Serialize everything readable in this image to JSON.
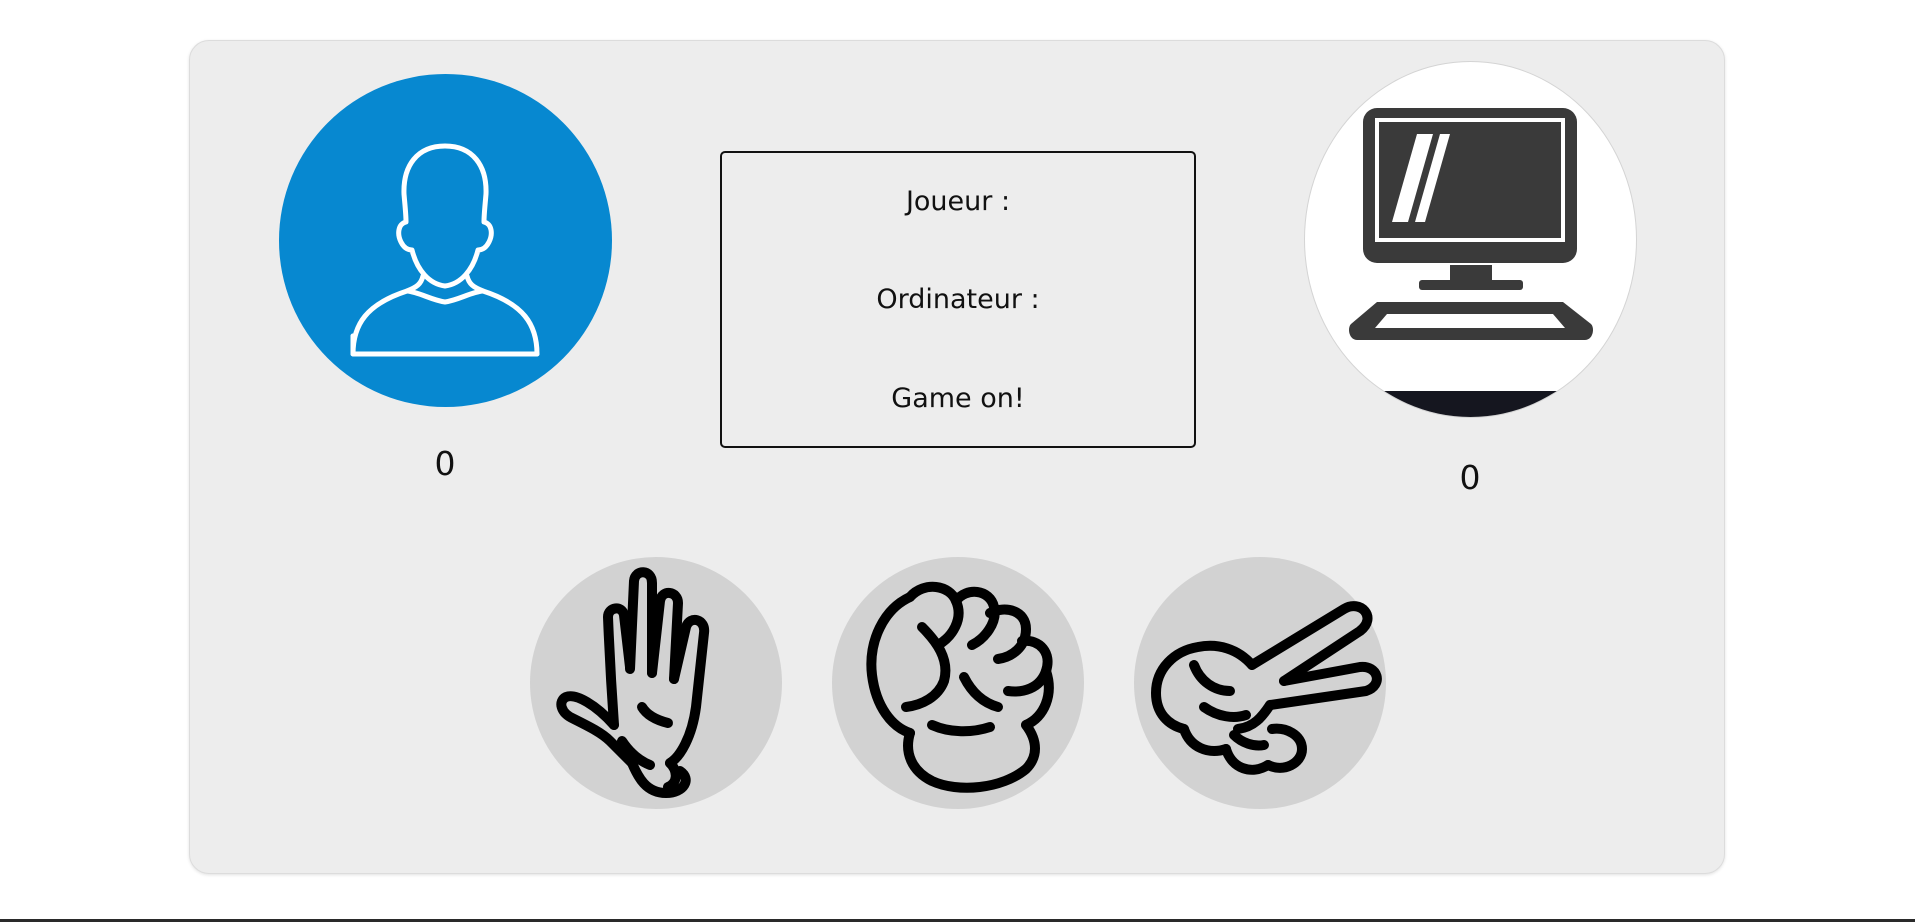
{
  "status": {
    "player_label": "Joueur :",
    "computer_label": "Ordinateur :",
    "result": "Game on!"
  },
  "scores": {
    "player": "0",
    "computer": "0"
  },
  "avatars": {
    "player_icon": "user-silhouette-icon",
    "computer_icon": "desktop-computer-icon"
  },
  "choices": [
    {
      "name": "paper",
      "icon": "open-hand-icon"
    },
    {
      "name": "rock",
      "icon": "fist-icon"
    },
    {
      "name": "scissors",
      "icon": "peace-hand-icon"
    }
  ],
  "colors": {
    "player_avatar": "#0788d0",
    "card_background": "#ededed",
    "choice_background": "#d2d2d2"
  }
}
